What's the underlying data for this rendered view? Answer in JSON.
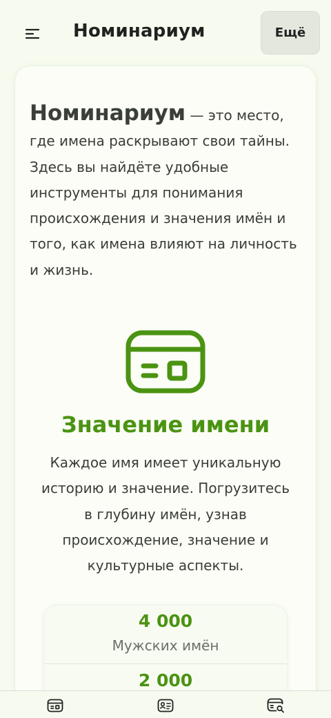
{
  "header": {
    "menu_icon": "menu-icon",
    "title": "Номинариум",
    "more_label": "Ещё"
  },
  "intro": {
    "brand": "Номинариум",
    "text": " — это место, где имена раскрывают свои тайны. Здесь вы найдёте удобные инструменты для понимания происхождения и значения имён и того, как имена влияют на личность и жизнь."
  },
  "feature": {
    "icon": "name-card-icon",
    "title": "Значение имени",
    "description": "Каждое имя имеет уникальную историю и значение. Погрузитесь в глубину имён, узнав происхождение, значение и культурные аспекты."
  },
  "stats": [
    {
      "value": "4 000",
      "label": "Мужских имён"
    },
    {
      "value": "2 000",
      "label": ""
    }
  ],
  "bottom_nav": [
    {
      "icon": "name-card-icon"
    },
    {
      "icon": "id-card-icon"
    },
    {
      "icon": "card-search-icon"
    }
  ],
  "colors": {
    "accent": "#4b9312",
    "background": "#f7fbef",
    "card": "#fbfdf6",
    "text": "#3a3d38"
  }
}
